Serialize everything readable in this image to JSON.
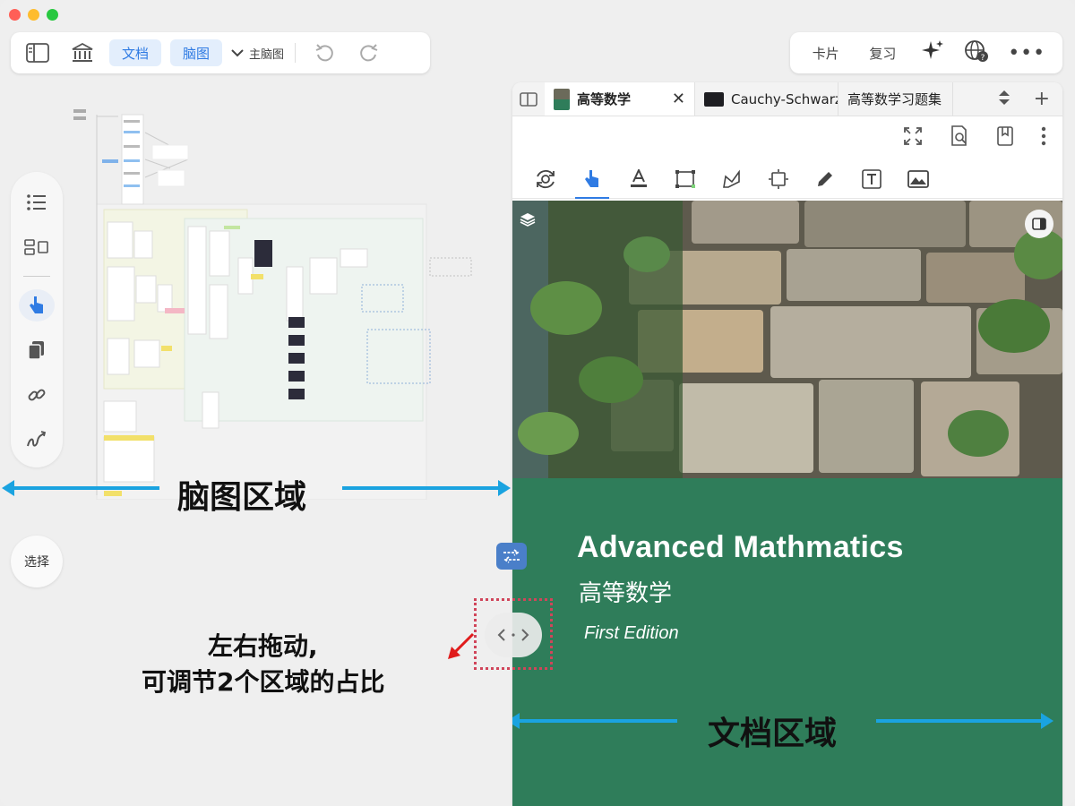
{
  "toolbar_left": {
    "doc_label": "文档",
    "mindmap_label": "脑图",
    "map_select": "主脑图"
  },
  "toolbar_right": {
    "cards_label": "卡片",
    "review_label": "复习"
  },
  "side": {
    "select_label": "选择"
  },
  "doc": {
    "tabs": [
      {
        "label": "高等数学"
      },
      {
        "label": "Cauchy-Schwarz..."
      },
      {
        "label": "高等数学习题集"
      }
    ],
    "cover": {
      "title": "Advanced Mathmatics",
      "subtitle": "高等数学",
      "edition": "First Edition"
    }
  },
  "annotations": {
    "mindmap_area": "脑图区域",
    "doc_area": "文档区域",
    "drag_line1": "左右拖动,",
    "drag_line2": "可调节2个区域的占比"
  },
  "colors": {
    "accent": "#2f7be3",
    "annotation_arrow": "#1aa3e0",
    "cover_green": "#2f7d5a"
  }
}
